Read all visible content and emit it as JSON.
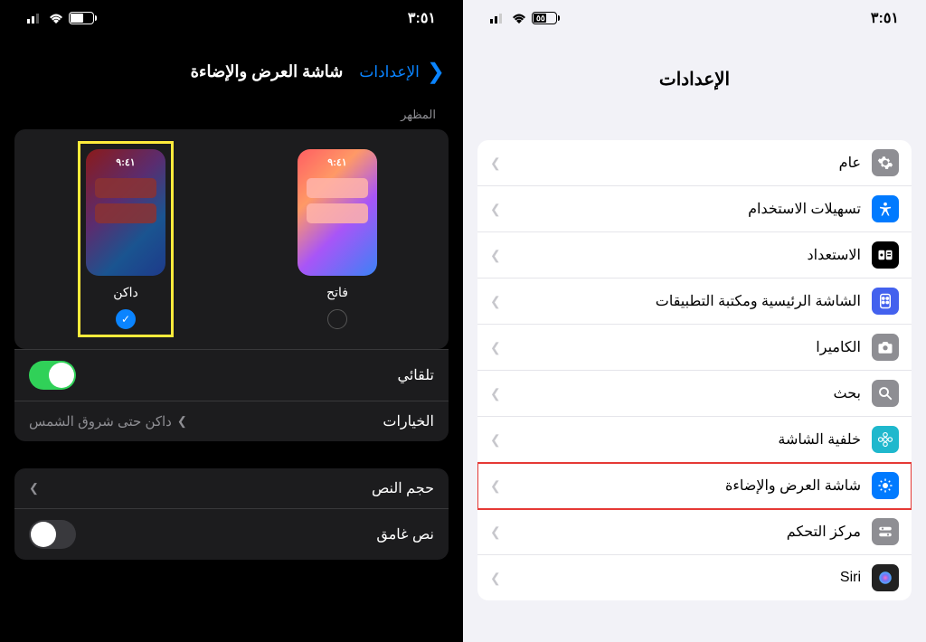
{
  "status": {
    "time": "٣:٥١",
    "battery": "٥٥"
  },
  "right_screen": {
    "title": "الإعدادات",
    "rows": [
      {
        "label": "عام",
        "icon_bg": "#8e8e93",
        "icon": "gear"
      },
      {
        "label": "تسهيلات الاستخدام",
        "icon_bg": "#007aff",
        "icon": "accessibility"
      },
      {
        "label": "الاستعداد",
        "icon_bg": "#000",
        "icon": "standby"
      },
      {
        "label": "الشاشة الرئيسية ومكتبة التطبيقات",
        "icon_bg": "#4361ee",
        "icon": "homescreen"
      },
      {
        "label": "الكاميرا",
        "icon_bg": "#8e8e93",
        "icon": "camera"
      },
      {
        "label": "بحث",
        "icon_bg": "#8e8e93",
        "icon": "search"
      },
      {
        "label": "خلفية الشاشة",
        "icon_bg": "#1fb8cd",
        "icon": "wallpaper"
      },
      {
        "label": "شاشة العرض والإضاءة",
        "icon_bg": "#007aff",
        "icon": "brightness",
        "highlighted": true
      },
      {
        "label": "مركز التحكم",
        "icon_bg": "#8e8e93",
        "icon": "controlcenter"
      },
      {
        "label": "Siri",
        "icon_bg": "#222",
        "icon": "siri"
      }
    ]
  },
  "left_screen": {
    "back_label": "الإعدادات",
    "title": "شاشة العرض والإضاءة",
    "appearance_section": "المظهر",
    "preview_time": "٩:٤١",
    "light_label": "فاتح",
    "dark_label": "داكن",
    "automatic_label": "تلقائي",
    "options_label": "الخيارات",
    "options_value": "داكن حتى شروق الشمس",
    "text_size_label": "حجم النص",
    "bold_text_label": "نص غامق"
  }
}
